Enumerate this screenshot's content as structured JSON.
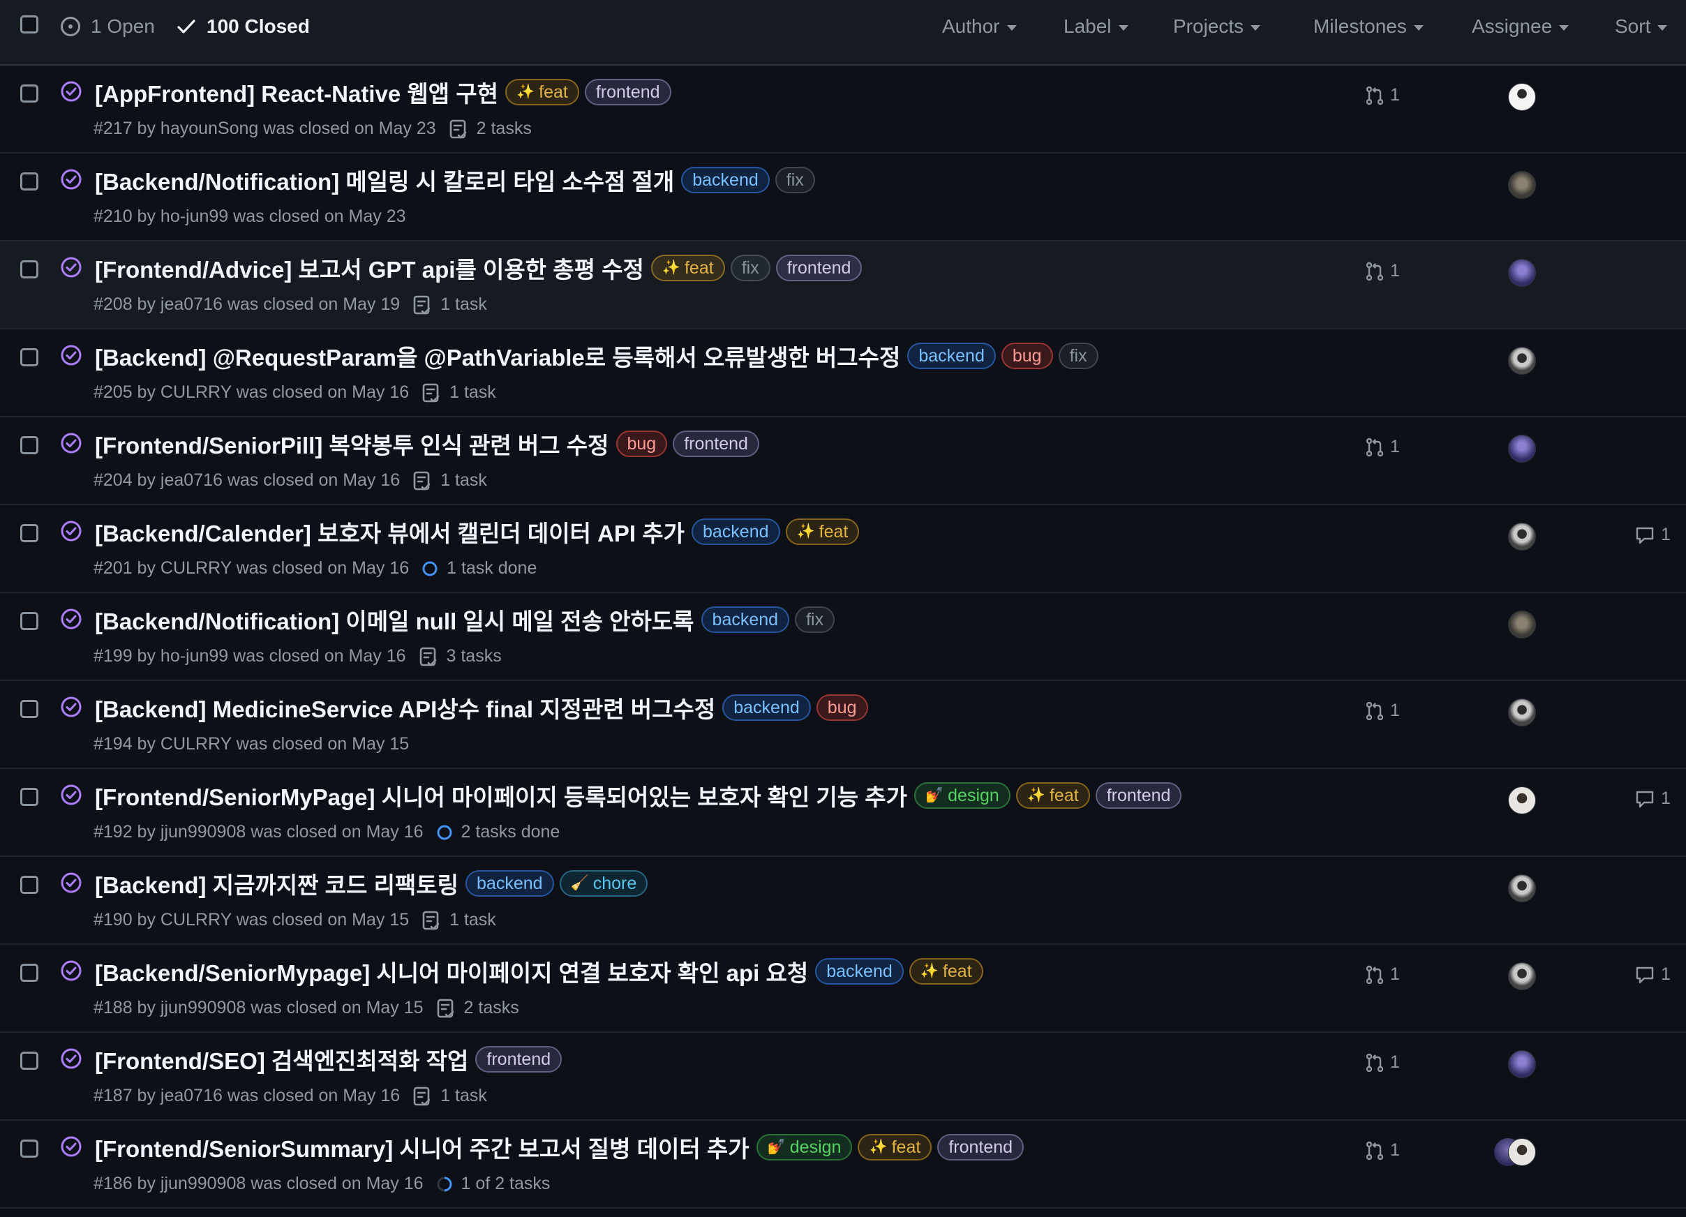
{
  "header": {
    "open_label": "1 Open",
    "closed_label": "100 Closed",
    "filters": [
      "Author",
      "Label",
      "Projects",
      "Milestones",
      "Assignee",
      "Sort"
    ]
  },
  "colors": {
    "background": "#0d1117",
    "closed_icon": "#ab7df8",
    "label_feat": "#e3b341",
    "label_frontend": "#d2cbe8",
    "label_backend": "#79c0ff",
    "label_fix": "#8b949e",
    "label_bug": "#ff9a94",
    "label_design": "#56d364",
    "label_chore": "#58c8f0"
  },
  "issues": [
    {
      "title": "[AppFrontend] React-Native 웹앱 구현",
      "labels": [
        {
          "text": "feat",
          "kind": "feat",
          "emoji": "✨"
        },
        {
          "text": "frontend",
          "kind": "frontend"
        }
      ],
      "meta": "#217 by hayounSong was closed on May 23",
      "task": "2 tasks",
      "task_icon": "list-icon",
      "pr": "1",
      "comments": null,
      "avatar": "a"
    },
    {
      "title": "[Backend/Notification] 메일링 시 칼로리 타입 소수점 절개",
      "labels": [
        {
          "text": "backend",
          "kind": "backend"
        },
        {
          "text": "fix",
          "kind": "fix"
        }
      ],
      "meta": "#210 by ho-jun99 was closed on May 23",
      "task": null,
      "pr": null,
      "comments": null,
      "avatar": "b"
    },
    {
      "title": "[Frontend/Advice] 보고서 GPT api를 이용한 총평 수정",
      "labels": [
        {
          "text": "feat",
          "kind": "feat",
          "emoji": "✨"
        },
        {
          "text": "fix",
          "kind": "fix"
        },
        {
          "text": "frontend",
          "kind": "frontend"
        }
      ],
      "meta": "#208 by jea0716 was closed on May 19",
      "task": "1 task",
      "task_icon": "list-icon",
      "pr": "1",
      "comments": null,
      "avatar": "c"
    },
    {
      "title": "[Backend] @RequestParam을 @PathVariable로 등록해서 오류발생한 버그수정",
      "labels": [
        {
          "text": "backend",
          "kind": "backend"
        },
        {
          "text": "bug",
          "kind": "bug"
        },
        {
          "text": "fix",
          "kind": "fix"
        }
      ],
      "meta": "#205 by CULRRY was closed on May 16",
      "task": "1 task",
      "task_icon": "list-icon",
      "pr": null,
      "comments": null,
      "avatar": "d"
    },
    {
      "title": "[Frontend/SeniorPill] 복약봉투 인식 관련 버그 수정",
      "labels": [
        {
          "text": "bug",
          "kind": "bug"
        },
        {
          "text": "frontend",
          "kind": "frontend"
        }
      ],
      "meta": "#204 by jea0716 was closed on May 16",
      "task": "1 task",
      "task_icon": "list-icon",
      "pr": "1",
      "comments": null,
      "avatar": "c"
    },
    {
      "title": "[Backend/Calender] 보호자 뷰에서 캘린더 데이터 API 추가",
      "labels": [
        {
          "text": "backend",
          "kind": "backend"
        },
        {
          "text": "feat",
          "kind": "feat",
          "emoji": "✨"
        }
      ],
      "meta": "#201 by CULRRY was closed on May 16",
      "task": "1 task done",
      "task_icon": "progress-icon",
      "pr": null,
      "comments": "1",
      "avatar": "d"
    },
    {
      "title": "[Backend/Notification] 이메일 null 일시 메일 전송 안하도록",
      "labels": [
        {
          "text": "backend",
          "kind": "backend"
        },
        {
          "text": "fix",
          "kind": "fix"
        }
      ],
      "meta": "#199 by ho-jun99 was closed on May 16",
      "task": "3 tasks",
      "task_icon": "list-icon",
      "pr": null,
      "comments": null,
      "avatar": "b"
    },
    {
      "title": "[Backend] MedicineService API상수 final 지정관련 버그수정",
      "labels": [
        {
          "text": "backend",
          "kind": "backend"
        },
        {
          "text": "bug",
          "kind": "bug"
        }
      ],
      "meta": "#194 by CULRRY was closed on May 15",
      "task": null,
      "pr": "1",
      "comments": null,
      "avatar": "d"
    },
    {
      "title": "[Frontend/SeniorMyPage] 시니어 마이페이지 등록되어있는 보호자 확인 기능 추가",
      "labels": [
        {
          "text": "design",
          "kind": "design",
          "emoji": "💅"
        },
        {
          "text": "feat",
          "kind": "feat",
          "emoji": "✨"
        },
        {
          "text": "frontend",
          "kind": "frontend"
        }
      ],
      "meta": "#192 by jjun990908 was closed on May 16",
      "task": "2 tasks done",
      "task_icon": "progress-icon",
      "pr": null,
      "comments": "1",
      "avatar": "e"
    },
    {
      "title": "[Backend] 지금까지짠 코드 리팩토링",
      "labels": [
        {
          "text": "backend",
          "kind": "backend"
        },
        {
          "text": "chore",
          "kind": "chore",
          "emoji": "🧹"
        }
      ],
      "meta": "#190 by CULRRY was closed on May 15",
      "task": "1 task",
      "task_icon": "list-icon",
      "pr": null,
      "comments": null,
      "avatar": "d"
    },
    {
      "title": "[Backend/SeniorMypage] 시니어 마이페이지 연결 보호자 확인 api 요청",
      "labels": [
        {
          "text": "backend",
          "kind": "backend"
        },
        {
          "text": "feat",
          "kind": "feat",
          "emoji": "✨"
        }
      ],
      "meta": "#188 by jjun990908 was closed on May 15",
      "task": "2 tasks",
      "task_icon": "list-icon",
      "pr": "1",
      "comments": "1",
      "avatar": "d"
    },
    {
      "title": "[Frontend/SEO] 검색엔진최적화 작업",
      "labels": [
        {
          "text": "frontend",
          "kind": "frontend"
        }
      ],
      "meta": "#187 by jea0716 was closed on May 16",
      "task": "1 task",
      "task_icon": "list-icon",
      "pr": "1",
      "comments": null,
      "avatar": "c"
    },
    {
      "title": "[Frontend/SeniorSummary] 시니어 주간 보고서 질병 데이터 추가",
      "labels": [
        {
          "text": "design",
          "kind": "design",
          "emoji": "💅"
        },
        {
          "text": "feat",
          "kind": "feat",
          "emoji": "✨"
        },
        {
          "text": "frontend",
          "kind": "frontend"
        }
      ],
      "meta": "#186 by jjun990908 was closed on May 16",
      "task": "1 of 2 tasks",
      "task_icon": "partial-progress-icon",
      "pr": "1",
      "comments": null,
      "avatar": "e2"
    }
  ]
}
